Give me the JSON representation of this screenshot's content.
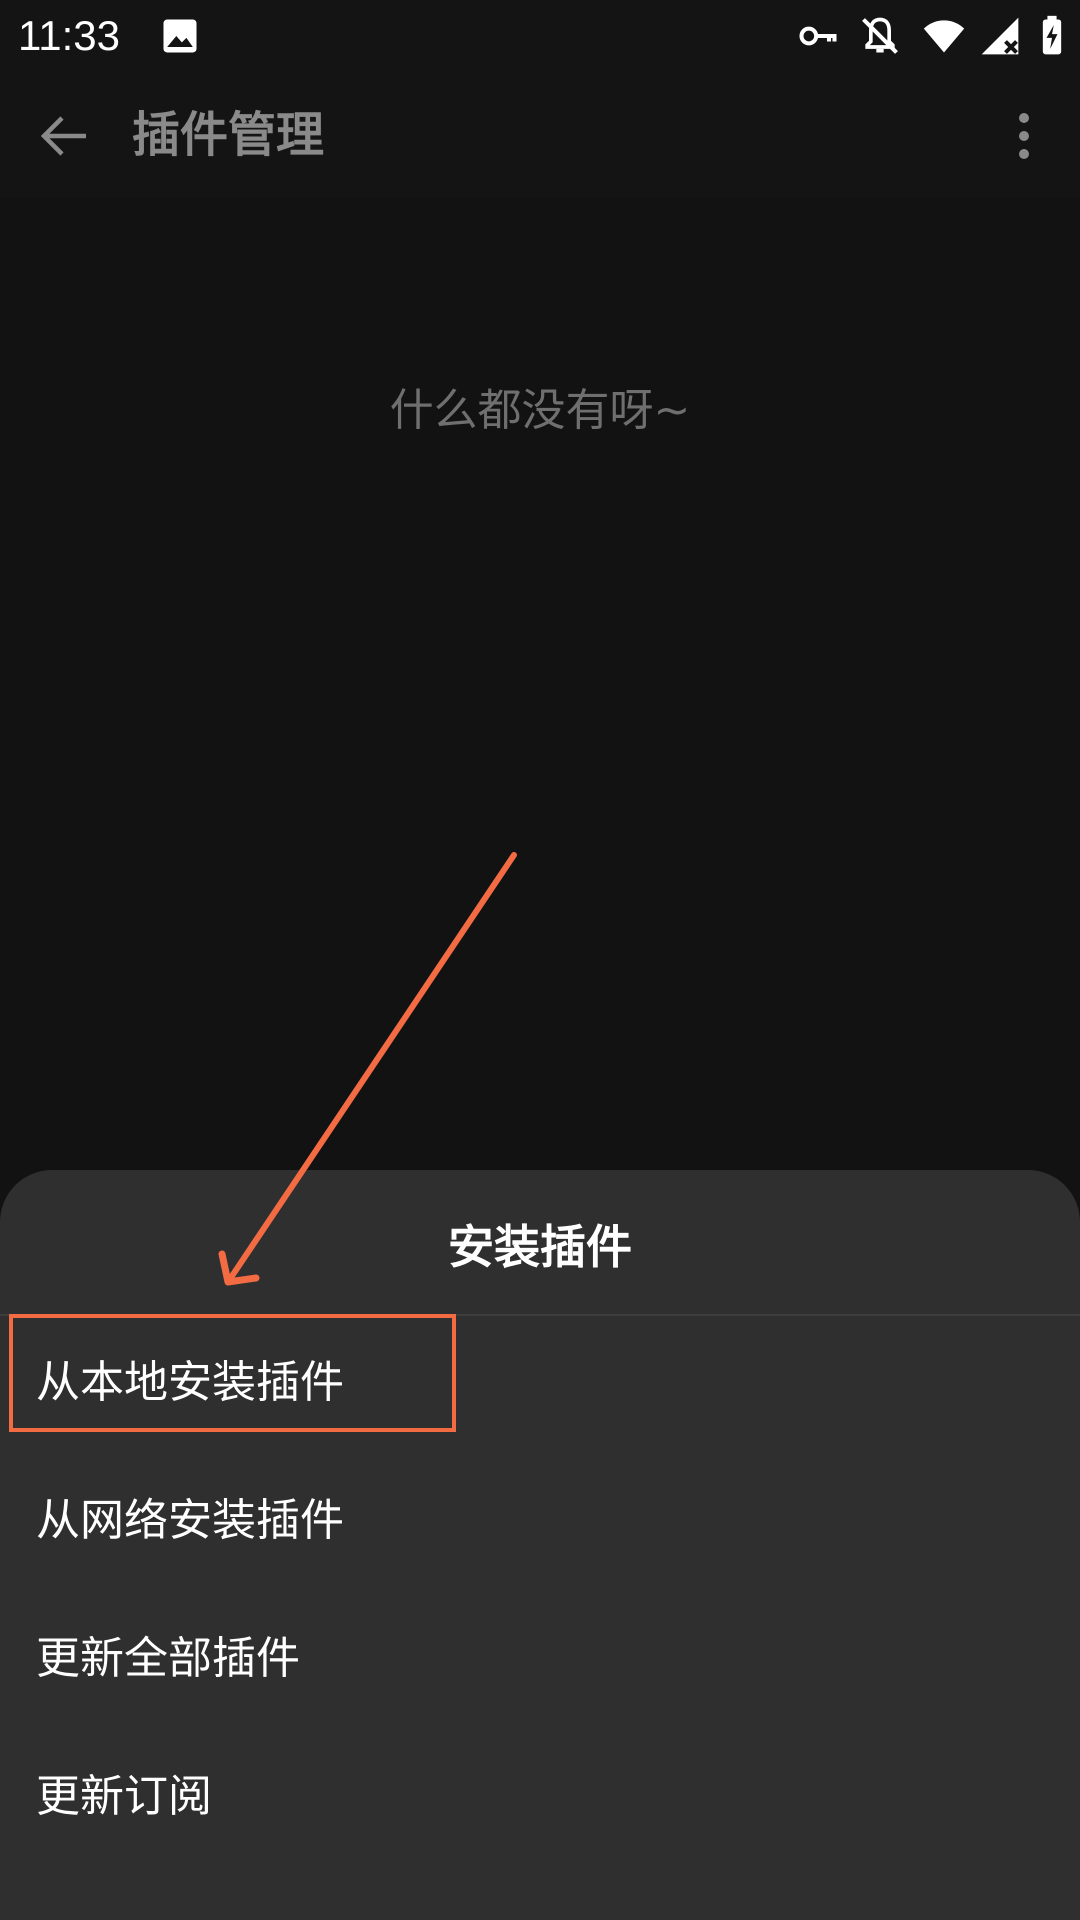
{
  "status_bar": {
    "time": "11:33",
    "icons": [
      "image-icon",
      "vpn-key-icon",
      "notifications-off-icon",
      "wifi-icon",
      "signal-icon",
      "battery-charging-icon"
    ]
  },
  "app_bar": {
    "title": "插件管理",
    "back_icon": "arrow-back-icon",
    "overflow_icon": "more-vert-icon"
  },
  "content": {
    "empty_text": "什么都没有呀~"
  },
  "sheet": {
    "title": "安装插件",
    "items": [
      {
        "label": "从本地安装插件"
      },
      {
        "label": "从网络安装插件"
      },
      {
        "label": "更新全部插件"
      },
      {
        "label": "更新订阅"
      }
    ]
  },
  "colors": {
    "background": "#121212",
    "sheet": "#2f2f2f",
    "annotation": "#f26b43"
  }
}
